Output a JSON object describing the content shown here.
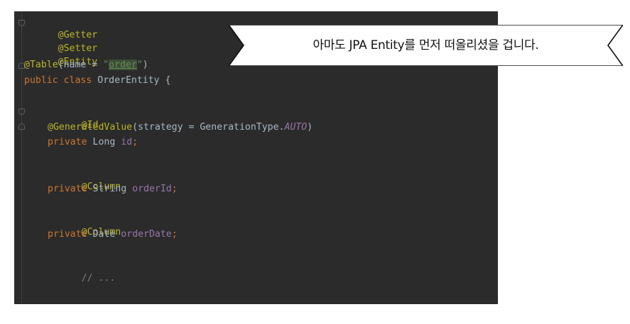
{
  "editor": {
    "lines": {
      "getter": "@Getter",
      "setter": "@Setter",
      "entity": "@Entity",
      "table_annot": "@Table",
      "table_open": "(name = ",
      "table_quote_open": "\"",
      "table_name": "order",
      "table_quote_close": "\"",
      "table_close": ")",
      "class_mod_public": "public",
      "class_kw": "class",
      "class_name": "OrderEntity {",
      "id_annot": "@Id",
      "gen_annot": "@GeneratedValue",
      "gen_args": "(strategy = GenerationType.",
      "gen_auto": "AUTO",
      "gen_close": ")",
      "id_private": "private",
      "id_type": "Long",
      "id_field": "id",
      "semi": ";",
      "col1_annot": "@Column",
      "order_id_private": "private",
      "order_id_type": "String",
      "order_id_field": "orderId",
      "col2_annot": "@Column",
      "order_date_private": "private",
      "order_date_type": "Date",
      "order_date_field": "orderDate",
      "comment": "// ...",
      "closing_brace": "}"
    }
  },
  "banner": {
    "text": "아마도 JPA Entity를 먼저 떠올리셨을 겁니다."
  },
  "colors": {
    "editor_bg": "#2b2b2b",
    "annotation": "#bbb529",
    "keyword": "#cc7832",
    "string": "#6a8759",
    "field": "#9876aa",
    "plain": "#a9b7c6",
    "comment": "#808080"
  }
}
